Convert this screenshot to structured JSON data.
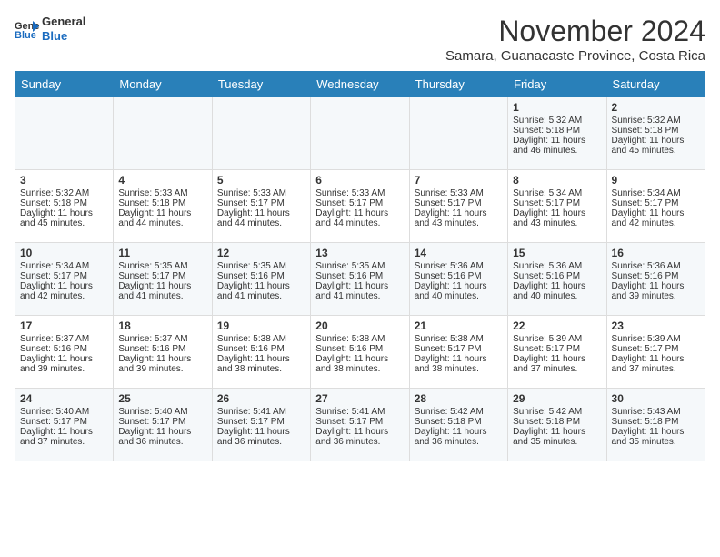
{
  "logo": {
    "line1": "General",
    "line2": "Blue"
  },
  "title": "November 2024",
  "location": "Samara, Guanacaste Province, Costa Rica",
  "weekdays": [
    "Sunday",
    "Monday",
    "Tuesday",
    "Wednesday",
    "Thursday",
    "Friday",
    "Saturday"
  ],
  "weeks": [
    [
      {
        "day": "",
        "info": ""
      },
      {
        "day": "",
        "info": ""
      },
      {
        "day": "",
        "info": ""
      },
      {
        "day": "",
        "info": ""
      },
      {
        "day": "",
        "info": ""
      },
      {
        "day": "1",
        "info": "Sunrise: 5:32 AM\nSunset: 5:18 PM\nDaylight: 11 hours\nand 46 minutes."
      },
      {
        "day": "2",
        "info": "Sunrise: 5:32 AM\nSunset: 5:18 PM\nDaylight: 11 hours\nand 45 minutes."
      }
    ],
    [
      {
        "day": "3",
        "info": "Sunrise: 5:32 AM\nSunset: 5:18 PM\nDaylight: 11 hours\nand 45 minutes."
      },
      {
        "day": "4",
        "info": "Sunrise: 5:33 AM\nSunset: 5:18 PM\nDaylight: 11 hours\nand 44 minutes."
      },
      {
        "day": "5",
        "info": "Sunrise: 5:33 AM\nSunset: 5:17 PM\nDaylight: 11 hours\nand 44 minutes."
      },
      {
        "day": "6",
        "info": "Sunrise: 5:33 AM\nSunset: 5:17 PM\nDaylight: 11 hours\nand 44 minutes."
      },
      {
        "day": "7",
        "info": "Sunrise: 5:33 AM\nSunset: 5:17 PM\nDaylight: 11 hours\nand 43 minutes."
      },
      {
        "day": "8",
        "info": "Sunrise: 5:34 AM\nSunset: 5:17 PM\nDaylight: 11 hours\nand 43 minutes."
      },
      {
        "day": "9",
        "info": "Sunrise: 5:34 AM\nSunset: 5:17 PM\nDaylight: 11 hours\nand 42 minutes."
      }
    ],
    [
      {
        "day": "10",
        "info": "Sunrise: 5:34 AM\nSunset: 5:17 PM\nDaylight: 11 hours\nand 42 minutes."
      },
      {
        "day": "11",
        "info": "Sunrise: 5:35 AM\nSunset: 5:17 PM\nDaylight: 11 hours\nand 41 minutes."
      },
      {
        "day": "12",
        "info": "Sunrise: 5:35 AM\nSunset: 5:16 PM\nDaylight: 11 hours\nand 41 minutes."
      },
      {
        "day": "13",
        "info": "Sunrise: 5:35 AM\nSunset: 5:16 PM\nDaylight: 11 hours\nand 41 minutes."
      },
      {
        "day": "14",
        "info": "Sunrise: 5:36 AM\nSunset: 5:16 PM\nDaylight: 11 hours\nand 40 minutes."
      },
      {
        "day": "15",
        "info": "Sunrise: 5:36 AM\nSunset: 5:16 PM\nDaylight: 11 hours\nand 40 minutes."
      },
      {
        "day": "16",
        "info": "Sunrise: 5:36 AM\nSunset: 5:16 PM\nDaylight: 11 hours\nand 39 minutes."
      }
    ],
    [
      {
        "day": "17",
        "info": "Sunrise: 5:37 AM\nSunset: 5:16 PM\nDaylight: 11 hours\nand 39 minutes."
      },
      {
        "day": "18",
        "info": "Sunrise: 5:37 AM\nSunset: 5:16 PM\nDaylight: 11 hours\nand 39 minutes."
      },
      {
        "day": "19",
        "info": "Sunrise: 5:38 AM\nSunset: 5:16 PM\nDaylight: 11 hours\nand 38 minutes."
      },
      {
        "day": "20",
        "info": "Sunrise: 5:38 AM\nSunset: 5:16 PM\nDaylight: 11 hours\nand 38 minutes."
      },
      {
        "day": "21",
        "info": "Sunrise: 5:38 AM\nSunset: 5:17 PM\nDaylight: 11 hours\nand 38 minutes."
      },
      {
        "day": "22",
        "info": "Sunrise: 5:39 AM\nSunset: 5:17 PM\nDaylight: 11 hours\nand 37 minutes."
      },
      {
        "day": "23",
        "info": "Sunrise: 5:39 AM\nSunset: 5:17 PM\nDaylight: 11 hours\nand 37 minutes."
      }
    ],
    [
      {
        "day": "24",
        "info": "Sunrise: 5:40 AM\nSunset: 5:17 PM\nDaylight: 11 hours\nand 37 minutes."
      },
      {
        "day": "25",
        "info": "Sunrise: 5:40 AM\nSunset: 5:17 PM\nDaylight: 11 hours\nand 36 minutes."
      },
      {
        "day": "26",
        "info": "Sunrise: 5:41 AM\nSunset: 5:17 PM\nDaylight: 11 hours\nand 36 minutes."
      },
      {
        "day": "27",
        "info": "Sunrise: 5:41 AM\nSunset: 5:17 PM\nDaylight: 11 hours\nand 36 minutes."
      },
      {
        "day": "28",
        "info": "Sunrise: 5:42 AM\nSunset: 5:18 PM\nDaylight: 11 hours\nand 36 minutes."
      },
      {
        "day": "29",
        "info": "Sunrise: 5:42 AM\nSunset: 5:18 PM\nDaylight: 11 hours\nand 35 minutes."
      },
      {
        "day": "30",
        "info": "Sunrise: 5:43 AM\nSunset: 5:18 PM\nDaylight: 11 hours\nand 35 minutes."
      }
    ]
  ]
}
